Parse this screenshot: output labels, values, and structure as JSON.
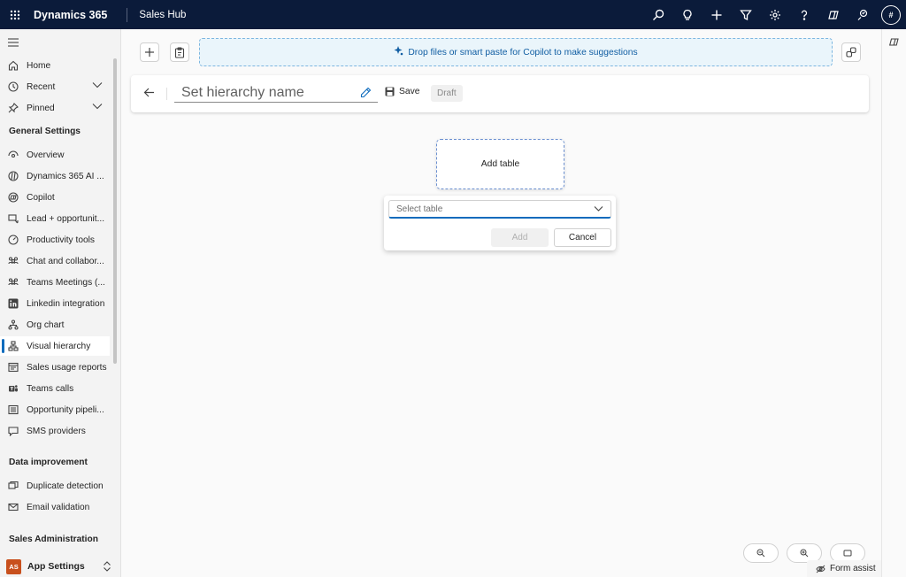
{
  "topbar": {
    "app_title": "Dynamics 365",
    "app_name": "Sales Hub",
    "avatar_initials": "#",
    "icons": [
      "search-icon",
      "lightbulb-icon",
      "plus-icon",
      "filter-icon",
      "gear-icon",
      "help-icon",
      "copilot-icon",
      "feedback-icon"
    ]
  },
  "sidebar": {
    "top_items": [
      {
        "label": "Home",
        "icon": "home-icon"
      },
      {
        "label": "Recent",
        "icon": "clock-icon",
        "expandable": true
      },
      {
        "label": "Pinned",
        "icon": "pin-icon",
        "expandable": true
      }
    ],
    "groups": [
      {
        "title": "General Settings",
        "items": [
          {
            "label": "Overview",
            "icon": "overview-icon"
          },
          {
            "label": "Dynamics 365 AI ...",
            "icon": "ai-icon"
          },
          {
            "label": "Copilot",
            "icon": "copilot-icon"
          },
          {
            "label": "Lead + opportunit...",
            "icon": "lead-icon"
          },
          {
            "label": "Productivity tools",
            "icon": "gauge-icon"
          },
          {
            "label": "Chat and collabor...",
            "icon": "people-icon"
          },
          {
            "label": "Teams Meetings (...",
            "icon": "people-icon"
          },
          {
            "label": "Linkedin integration",
            "icon": "linkedin-icon"
          },
          {
            "label": "Org chart",
            "icon": "org-chart-icon"
          },
          {
            "label": "Visual hierarchy",
            "icon": "hierarchy-icon",
            "active": true
          },
          {
            "label": "Sales usage reports",
            "icon": "report-icon"
          },
          {
            "label": "Teams calls",
            "icon": "teams-icon"
          },
          {
            "label": "Opportunity pipeli...",
            "icon": "pipeline-icon"
          },
          {
            "label": "SMS providers",
            "icon": "chat-icon"
          }
        ]
      },
      {
        "title": "Data improvement",
        "items": [
          {
            "label": "Duplicate detection",
            "icon": "duplicate-icon"
          },
          {
            "label": "Email validation",
            "icon": "mail-icon"
          }
        ]
      },
      {
        "title": "Sales Administration",
        "items": []
      }
    ],
    "app_settings": {
      "badge": "AS",
      "label": "App Settings"
    }
  },
  "toolbar": {
    "copilot_text": "Drop files or smart paste for Copilot to make suggestions"
  },
  "header": {
    "name_placeholder": "Set hierarchy name",
    "save_label": "Save",
    "status_label": "Draft"
  },
  "canvas": {
    "node_label": "Add table",
    "select_placeholder": "Select table",
    "add_label": "Add",
    "cancel_label": "Cancel"
  },
  "footer": {
    "form_assist_label": "Form assist"
  },
  "colors": {
    "topbar_bg": "#0b1b3a",
    "accent": "#0f6cbd",
    "copilot_bg": "#eaf5fb",
    "badge_bg": "#c8501d"
  }
}
